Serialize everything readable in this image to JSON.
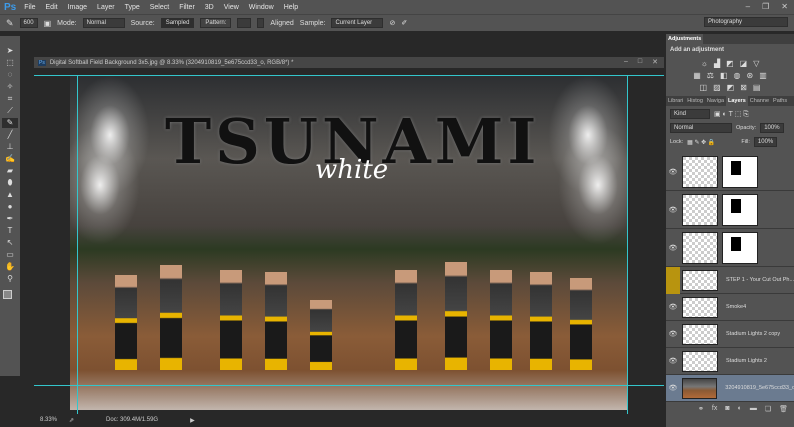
{
  "app": {
    "logo": "Ps"
  },
  "menu": [
    "File",
    "Edit",
    "Image",
    "Layer",
    "Type",
    "Select",
    "Filter",
    "3D",
    "View",
    "Window",
    "Help"
  ],
  "options": {
    "brush_size": "600",
    "mode_label": "Mode:",
    "mode_value": "Normal",
    "source_label": "Source:",
    "source_sampled": "Sampled",
    "source_pattern": "Pattern:",
    "aligned_label": "Aligned",
    "sample_label": "Sample:",
    "sample_value": "Current Layer",
    "workspace": "Photography"
  },
  "tools": [
    "move-tool",
    "marquee-tool",
    "lasso-tool",
    "quick-select-tool",
    "crop-tool",
    "eyedropper-tool",
    "healing-brush-tool",
    "brush-tool",
    "clone-stamp-tool",
    "history-brush-tool",
    "eraser-tool",
    "paint-bucket-tool",
    "blur-tool",
    "dodge-tool",
    "pen-tool",
    "type-tool",
    "path-select-tool",
    "rectangle-tool",
    "hand-tool",
    "zoom-tool"
  ],
  "document": {
    "title": "Digital Softball Field Background 3x5.jpg @ 8.33% (3204910819_5e675ccd33_o, RGB/8*) *",
    "zoom": "8.33%",
    "doc_size": "Doc: 309.4M/1.59G"
  },
  "artwork": {
    "headline": "TSUNAMI",
    "subhead": "white"
  },
  "adjustments": {
    "tab": "Adjustments",
    "heading": "Add an adjustment"
  },
  "layers_panel": {
    "tabs": [
      "Librari",
      "Histog",
      "Naviga",
      "Layers",
      "Channe",
      "Paths"
    ],
    "active_tab": "Layers",
    "filter": "Kind",
    "blend_mode": "Normal",
    "opacity_label": "Opacity:",
    "opacity": "100%",
    "lock_label": "Lock:",
    "fill_label": "Fill:",
    "fill": "100%",
    "layers": [
      {
        "name": "",
        "mask": true,
        "visible": true
      },
      {
        "name": "",
        "mask": true,
        "visible": true
      },
      {
        "name": "",
        "mask": true,
        "visible": true
      },
      {
        "name": "STEP 1 - Your Cut Out Ph...",
        "mask": false,
        "visible": false,
        "highlight": "#b8940f"
      },
      {
        "name": "Smoke4",
        "mask": false,
        "visible": true
      },
      {
        "name": "Stadium Lights 2 copy",
        "mask": false,
        "visible": true
      },
      {
        "name": "Stadium Lights 2",
        "mask": false,
        "visible": true
      },
      {
        "name": "3204910819_5e675ccd33_o",
        "mask": false,
        "visible": true,
        "selected": true
      }
    ]
  }
}
